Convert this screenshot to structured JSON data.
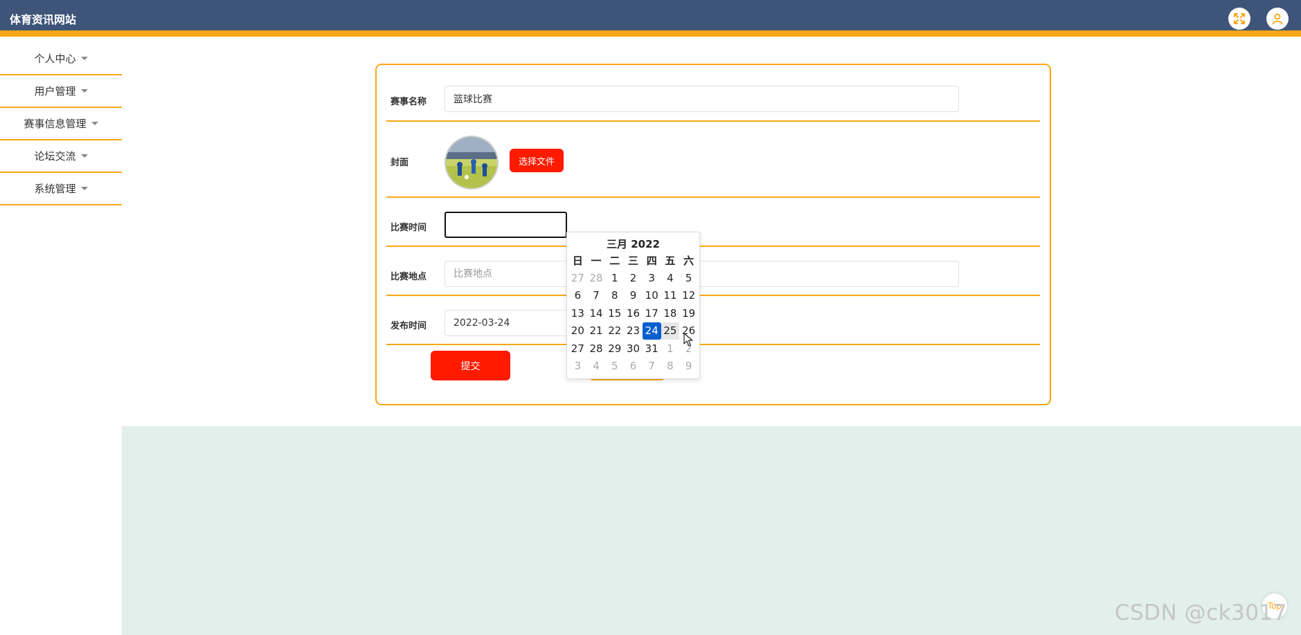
{
  "header": {
    "brand": "体育资讯网站",
    "fullscreen_icon": "expand-arrows",
    "user_icon": "user"
  },
  "sidebar": {
    "items": [
      {
        "label": "个人中心"
      },
      {
        "label": "用户管理"
      },
      {
        "label": "赛事信息管理"
      },
      {
        "label": "论坛交流"
      },
      {
        "label": "系统管理"
      }
    ]
  },
  "form": {
    "event_name": {
      "label": "赛事名称",
      "value": "篮球比赛"
    },
    "cover": {
      "label": "封面",
      "choose_button": "选择文件"
    },
    "match_time": {
      "label": "比赛时间",
      "value": ""
    },
    "match_location": {
      "label": "比赛地点",
      "value": "",
      "placeholder": "比赛地点"
    },
    "publish_time": {
      "label": "发布时间",
      "value": "2022-03-24"
    },
    "submit_button": "提交"
  },
  "calendar": {
    "title": "三月 2022",
    "weekdays": [
      "日",
      "一",
      "二",
      "三",
      "四",
      "五",
      "六"
    ],
    "selected": "24",
    "hovered": "25",
    "weeks": [
      [
        {
          "d": "27",
          "m": true
        },
        {
          "d": "28",
          "m": true
        },
        {
          "d": "1"
        },
        {
          "d": "2"
        },
        {
          "d": "3"
        },
        {
          "d": "4"
        },
        {
          "d": "5"
        }
      ],
      [
        {
          "d": "6"
        },
        {
          "d": "7"
        },
        {
          "d": "8"
        },
        {
          "d": "9"
        },
        {
          "d": "10"
        },
        {
          "d": "11"
        },
        {
          "d": "12"
        }
      ],
      [
        {
          "d": "13"
        },
        {
          "d": "14"
        },
        {
          "d": "15"
        },
        {
          "d": "16"
        },
        {
          "d": "17"
        },
        {
          "d": "18"
        },
        {
          "d": "19"
        }
      ],
      [
        {
          "d": "20"
        },
        {
          "d": "21"
        },
        {
          "d": "22"
        },
        {
          "d": "23"
        },
        {
          "d": "24"
        },
        {
          "d": "25"
        },
        {
          "d": "26"
        }
      ],
      [
        {
          "d": "27"
        },
        {
          "d": "28"
        },
        {
          "d": "29"
        },
        {
          "d": "30"
        },
        {
          "d": "31"
        },
        {
          "d": "1",
          "m": true
        },
        {
          "d": "2",
          "m": true
        }
      ],
      [
        {
          "d": "3",
          "m": true
        },
        {
          "d": "4",
          "m": true
        },
        {
          "d": "5",
          "m": true
        },
        {
          "d": "6",
          "m": true
        },
        {
          "d": "7",
          "m": true
        },
        {
          "d": "8",
          "m": true
        },
        {
          "d": "9",
          "m": true
        }
      ]
    ]
  },
  "back_to_top": "Top",
  "watermark": "CSDN @ck3017",
  "colors": {
    "header": "#3e5579",
    "accent": "#f7a715",
    "button": "#ff1a00",
    "selected": "#0b5fcf",
    "content_bg": "#e3efeb"
  }
}
